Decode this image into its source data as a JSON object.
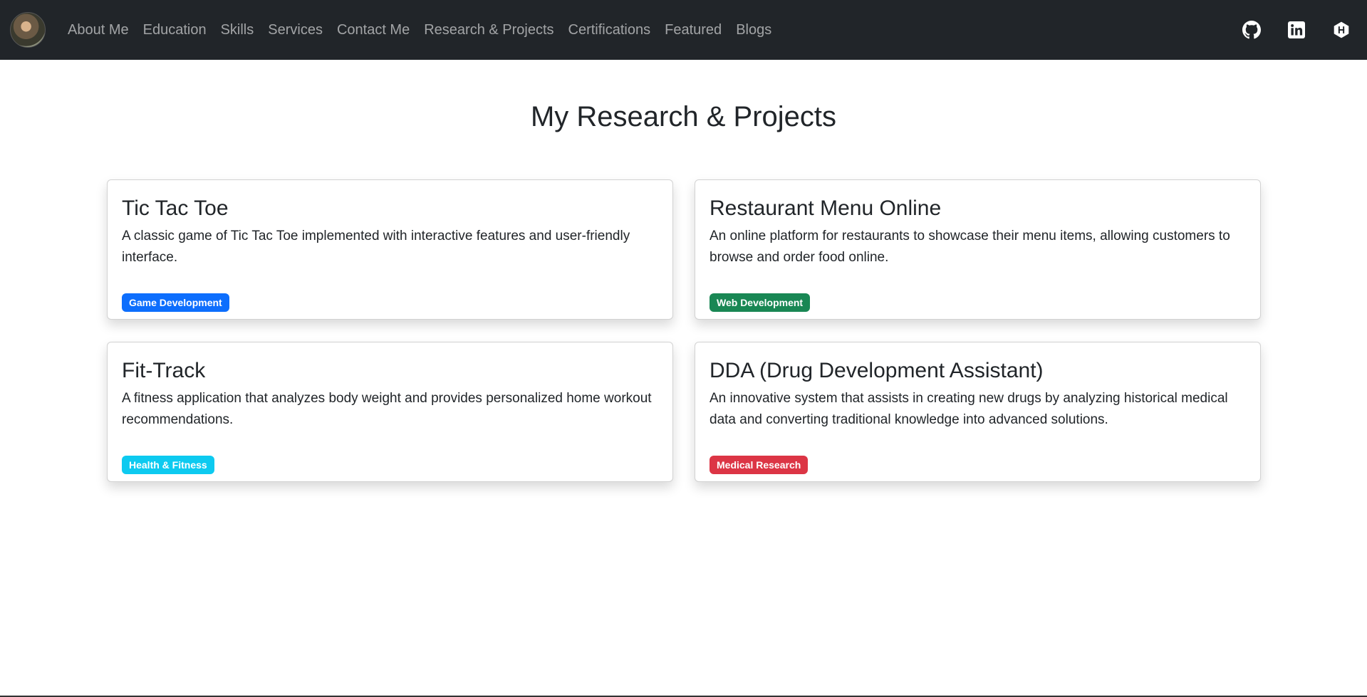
{
  "nav": {
    "links": [
      "About Me",
      "Education",
      "Skills",
      "Services",
      "Contact Me",
      "Research & Projects",
      "Certifications",
      "Featured",
      "Blogs"
    ],
    "icons": [
      "github-icon",
      "linkedin-icon",
      "hashnode-icon"
    ]
  },
  "page": {
    "title": "My Research & Projects"
  },
  "projects": [
    {
      "title": "Tic Tac Toe",
      "description": "A classic game of Tic Tac Toe implemented with interactive features and user-friendly interface.",
      "tag": "Game Development",
      "tag_color": "#0d6efd"
    },
    {
      "title": "Restaurant Menu Online",
      "description": "An online platform for restaurants to showcase their menu items, allowing customers to browse and order food online.",
      "tag": "Web Development",
      "tag_color": "#198754"
    },
    {
      "title": "Fit-Track",
      "description": "A fitness application that analyzes body weight and provides personalized home workout recommendations.",
      "tag": "Health & Fitness",
      "tag_color": "#0dcaf0"
    },
    {
      "title": "DDA (Drug Development Assistant)",
      "description": "An innovative system that assists in creating new drugs by analyzing historical medical data and converting traditional knowledge into advanced solutions.",
      "tag": "Medical Research",
      "tag_color": "#dc3545"
    }
  ]
}
